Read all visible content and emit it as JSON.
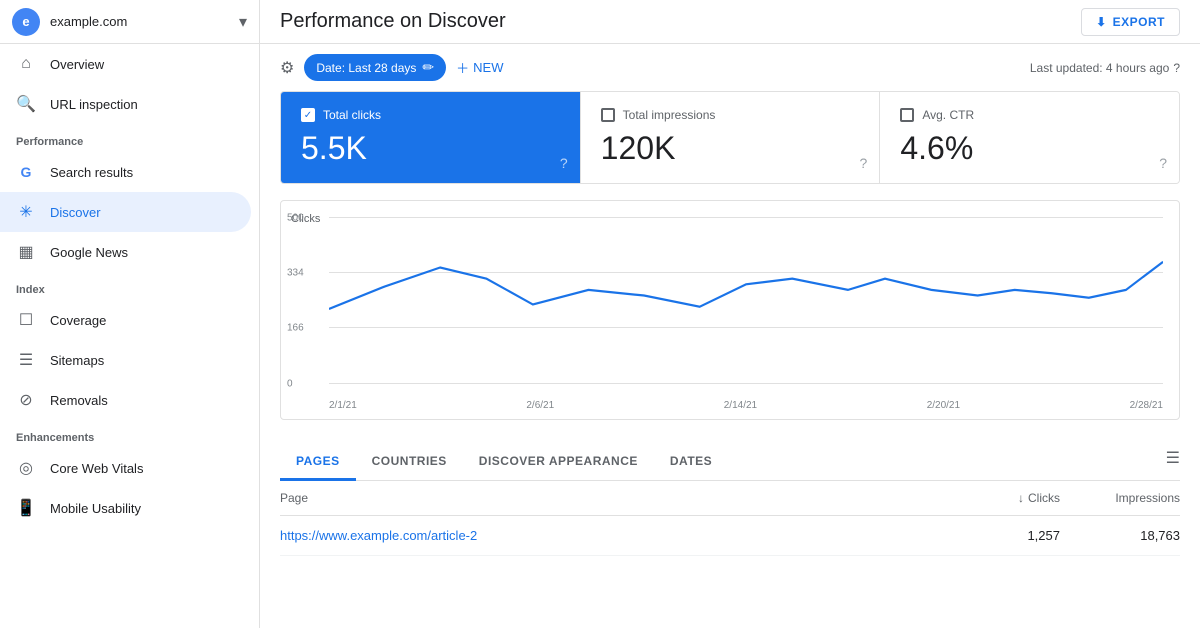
{
  "sidebar": {
    "domain": "example.com",
    "app_initial": "e",
    "dropdown_icon": "▾",
    "nav": {
      "overview_label": "Overview",
      "url_inspection_label": "URL inspection"
    },
    "performance_section": "Performance",
    "performance_items": [
      {
        "id": "search-results",
        "label": "Search results",
        "icon": "G"
      },
      {
        "id": "discover",
        "label": "Discover",
        "icon": "✳",
        "active": true
      },
      {
        "id": "google-news",
        "label": "Google News",
        "icon": "▦"
      }
    ],
    "index_section": "Index",
    "index_items": [
      {
        "id": "coverage",
        "label": "Coverage",
        "icon": "☐"
      },
      {
        "id": "sitemaps",
        "label": "Sitemaps",
        "icon": "☰"
      },
      {
        "id": "removals",
        "label": "Removals",
        "icon": "⊘"
      }
    ],
    "enhancements_section": "Enhancements",
    "enhancements_items": [
      {
        "id": "core-web-vitals",
        "label": "Core Web Vitals",
        "icon": "◎"
      },
      {
        "id": "mobile-usability",
        "label": "Mobile Usability",
        "icon": "📱"
      }
    ]
  },
  "main": {
    "title": "Performance on Discover",
    "export_label": "EXPORT",
    "filter_bar": {
      "date_pill": "Date: Last 28 days",
      "new_label": "NEW",
      "last_updated": "Last updated: 4 hours ago"
    },
    "metrics": [
      {
        "id": "total-clicks",
        "label": "Total clicks",
        "value": "5.5K",
        "active": true
      },
      {
        "id": "total-impressions",
        "label": "Total impressions",
        "value": "120K",
        "active": false
      },
      {
        "id": "avg-ctr",
        "label": "Avg. CTR",
        "value": "4.6%",
        "active": false
      }
    ],
    "chart": {
      "y_label": "Clicks",
      "y_values": [
        "500",
        "334",
        "166",
        "0"
      ],
      "x_labels": [
        "2/1/21",
        "2/6/21",
        "2/14/21",
        "2/20/21",
        "2/28/21"
      ],
      "line_color": "#1a73e8"
    },
    "tabs": [
      {
        "id": "pages",
        "label": "PAGES",
        "active": true
      },
      {
        "id": "countries",
        "label": "COUNTRIES",
        "active": false
      },
      {
        "id": "discover-appearance",
        "label": "DISCOVER APPEARANCE",
        "active": false
      },
      {
        "id": "dates",
        "label": "DATES",
        "active": false
      }
    ],
    "table": {
      "col_page": "Page",
      "col_clicks": "Clicks",
      "col_impressions": "Impressions",
      "rows": [
        {
          "page": "https://www.example.com/article-2",
          "clicks": "1,257",
          "impressions": "18,763"
        }
      ]
    }
  }
}
